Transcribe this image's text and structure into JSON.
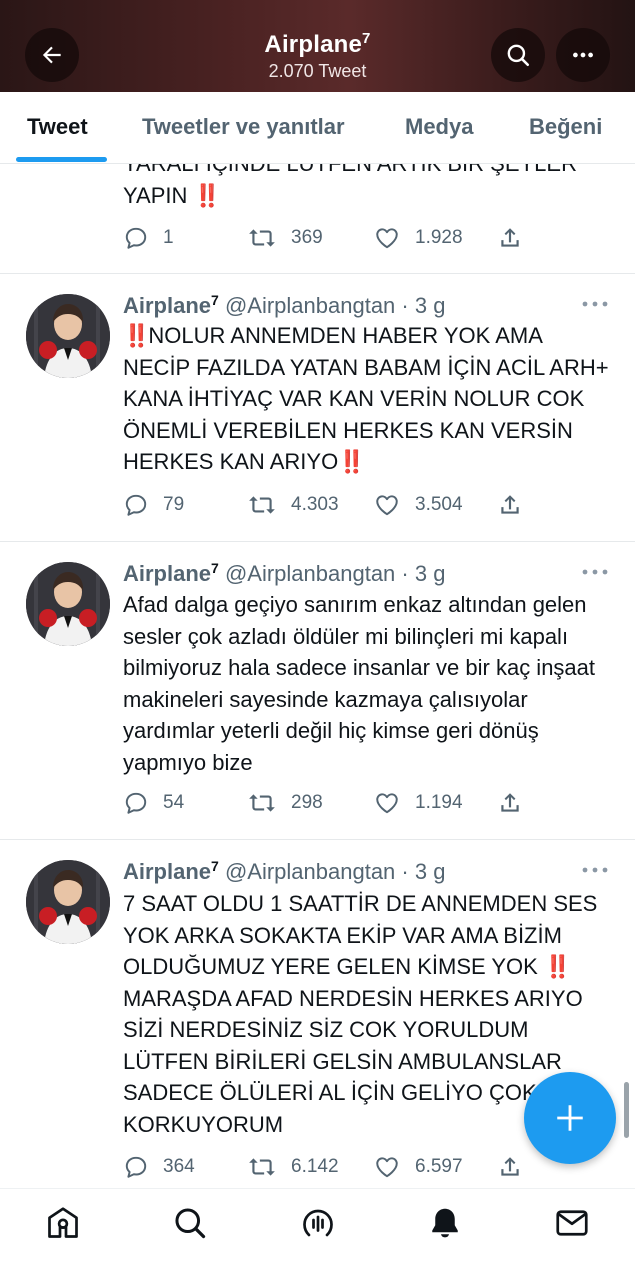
{
  "header": {
    "title": "Airplane",
    "title_sup": "7",
    "subtitle": "2.070 Tweet",
    "back_icon": "arrow-left-icon",
    "search_icon": "search-icon",
    "more_icon": "more-horizontal-icon",
    "gradient_colors": [
      "#2a1616",
      "#5a2a2a",
      "#231313"
    ]
  },
  "tabs": [
    {
      "label": "Tweet",
      "active": true
    },
    {
      "label": "Tweetler ve yanıtlar",
      "active": false
    },
    {
      "label": "Medya",
      "active": false
    },
    {
      "label": "Beğeni",
      "active": false
    }
  ],
  "accent_color": "#1d9bf0",
  "tweets": [
    {
      "partial": true,
      "text_lines": [
        "YARALI İÇİNDE LÜTFEN ARTIK BİR ŞEYLER",
        "YAPIN"
      ],
      "text_suffix": "‼️",
      "replies": "1",
      "retweets": "369",
      "likes": "1.928"
    },
    {
      "name": "Airplane",
      "name_sup": "7",
      "handle_time": "@Airplanbangtan · 3 g",
      "text_prefix": "‼️",
      "text": "NOLUR ANNEMDEN HABER YOK AMA NECİP FAZILDA YATAN BABAM İÇİN ACİL ARH+ KANA İHTİYAÇ VAR KAN VERİN NOLUR COK ÖNEMLİ VEREBİLEN HERKES KAN VERSİN HERKES KAN ARIYO",
      "text_suffix": "‼️",
      "replies": "79",
      "retweets": "4.303",
      "likes": "3.504"
    },
    {
      "name": "Airplane",
      "name_sup": "7",
      "handle_time": "@Airplanbangtan · 3 g",
      "text": "Afad dalga geçiyo sanırım enkaz altından gelen sesler çok azladı öldüler mi bilinçleri mi kapalı bilmiyoruz hala sadece insanlar ve bir kaç inşaat makineleri sayesinde kazmaya çalısıyolar yardımlar yeterli değil hiç kimse geri dönüş yapmıyo bize",
      "replies": "54",
      "retweets": "298",
      "likes": "1.194"
    },
    {
      "name": "Airplane",
      "name_sup": "7",
      "handle_time": "@Airplanbangtan · 3 g",
      "text_part1": "7 SAAT OLDU 1 SAATTİR DE ANNEMDEN SES YOK ARKA SOKAKTA EKİP VAR AMA BİZİM OLDUĞUMUZ YERE GELEN KİMSE YOK",
      "text_mid": "‼️",
      "text_part2": "MARAŞDA AFAD NERDESİN HERKES ARIYO SİZİ NERDESİNİZ SİZ COK YORULDUM LÜTFEN BİRİLERİ GELSİN AMBULANSLAR SADECE ÖLÜLERİ AL İÇİN GELİYO ÇOK KORKUYORUM",
      "replies": "364",
      "retweets": "6.142",
      "likes": "6.597"
    }
  ],
  "fab": {
    "icon": "plus-icon"
  },
  "bottom_nav": [
    {
      "icon": "home-icon"
    },
    {
      "icon": "search-icon"
    },
    {
      "icon": "spaces-icon"
    },
    {
      "icon": "notifications-bell-icon"
    },
    {
      "icon": "messages-envelope-icon"
    }
  ]
}
